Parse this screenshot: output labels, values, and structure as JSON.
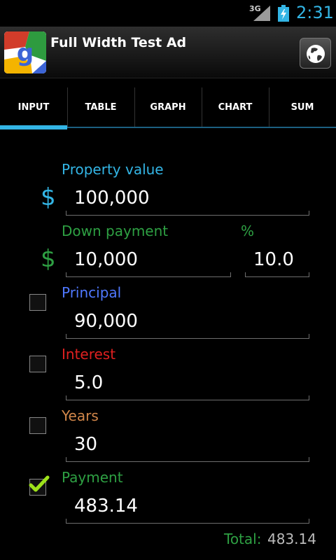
{
  "status": {
    "network": "3G",
    "time": "2:31"
  },
  "ad": {
    "title": "Full Width Test Ad"
  },
  "tabs": [
    "INPUT",
    "TABLE",
    "GRAPH",
    "CHART",
    "SUM"
  ],
  "form": {
    "property_label": "Property value",
    "property_value": "100,000",
    "down_label": "Down payment",
    "down_value": "10,000",
    "percent_label": "%",
    "percent_value": "10.0",
    "principal_label": "Principal",
    "principal_value": "90,000",
    "interest_label": "Interest",
    "interest_value": "5.0",
    "years_label": "Years",
    "years_value": "30",
    "payment_label": "Payment",
    "payment_value": "483.14",
    "currency_symbol": "$",
    "payment_checked": true
  },
  "summary": {
    "total_label": "Total:",
    "total_value": "483.14"
  },
  "colors": {
    "accent": "#33b5e5",
    "down": "#2ea043",
    "principal": "#4f78ff",
    "interest": "#e02020",
    "years": "#d2874a",
    "payment": "#2ea043"
  }
}
